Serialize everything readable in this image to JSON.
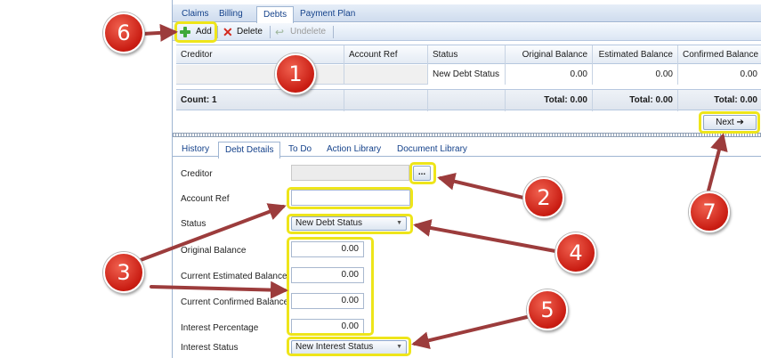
{
  "top_tabs": [
    "Claims",
    "Billing",
    "Debts",
    "Payment Plan"
  ],
  "top_tabs_active": "Debts",
  "toolbar": {
    "add_label": "Add",
    "delete_label": "Delete",
    "undelete_label": "Undelete"
  },
  "grid": {
    "columns": [
      "Creditor",
      "Account Ref",
      "Status",
      "Original Balance",
      "Estimated Balance",
      "Confirmed Balance"
    ],
    "rows": [
      [
        "",
        "",
        "New Debt Status",
        "0.00",
        "0.00",
        "0.00"
      ]
    ],
    "footer": {
      "count_label": "Count: 1",
      "totals": [
        "Total: 0.00",
        "Total: 0.00",
        "Total: 0.00"
      ]
    }
  },
  "next_button": {
    "label": "Next",
    "arrow": "➔"
  },
  "bottom_tabs": [
    "History",
    "Debt Details",
    "To Do",
    "Action Library",
    "Document Library"
  ],
  "bottom_tabs_active": "Debt Details",
  "form": {
    "creditor_label": "Creditor",
    "creditor_value": "",
    "ellipsis_label": "...",
    "account_ref_label": "Account Ref",
    "account_ref_value": "",
    "status_label": "Status",
    "status_value": "New Debt Status",
    "original_balance_label": "Original Balance",
    "original_balance_value": "0.00",
    "estimated_balance_label": "Current Estimated Balance",
    "estimated_balance_value": "0.00",
    "confirmed_balance_label": "Current Confirmed Balance",
    "confirmed_balance_value": "0.00",
    "interest_percentage_label": "Interest Percentage",
    "interest_percentage_value": "0.00",
    "interest_status_label": "Interest Status",
    "interest_status_value": "New Interest Status"
  },
  "callouts": [
    "1",
    "2",
    "3",
    "4",
    "5",
    "6",
    "7"
  ],
  "colors": {
    "highlight": "#eee51a",
    "callout": "#c91c12",
    "arrow": "#9c3c3c",
    "tab_text": "#15428b"
  }
}
